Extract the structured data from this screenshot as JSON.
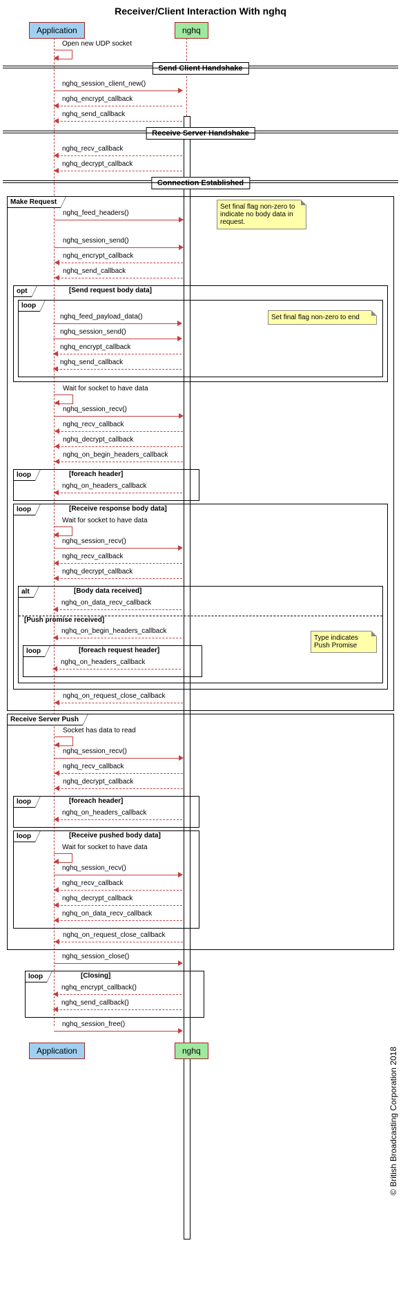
{
  "title": "Receiver/Client Interaction With nghq",
  "actors": {
    "app": "Application",
    "nghq": "nghq"
  },
  "dividers": {
    "send": "Send Client Handshake",
    "recv": "Receive Server Handshake",
    "est": "Connection Established"
  },
  "selfmsgs": {
    "openSocket": "Open new UDP socket",
    "waitData": "Wait for socket to have data",
    "socketData": "Socket has data to read"
  },
  "msgs": {
    "session_new": "nghq_session_client_new()",
    "encrypt_cb": "nghq_encrypt_callback",
    "send_cb": "nghq_send_callback",
    "recv_cb": "nghq_recv_callback",
    "decrypt_cb": "nghq_decrypt_callback",
    "feed_headers": "nghq_feed_headers()",
    "session_send": "nghq_session_send()",
    "feed_payload": "nghq_feed_payload_data()",
    "session_recv": "nghq_session_recv()",
    "begin_headers": "nghq_on_begin_headers_callback",
    "headers_cb": "nghq_on_headers_callback",
    "data_recv_cb": "nghq_on_data_recv_callback",
    "req_close_cb": "nghq_on_request_close_callback",
    "session_close": "nghq_session_close()",
    "encrypt_cb_call": "nghq_encrypt_callback()",
    "send_cb_call": "nghq_send_callback()",
    "session_free": "nghq_session_free()"
  },
  "groups": {
    "makeReq": "Make Request",
    "opt": "opt",
    "optTitle": "[Send request body data]",
    "loop": "loop",
    "foreachHeader": "[foreach header]",
    "recvBody": "[Receive response body data]",
    "alt": "alt",
    "altBody": "[Body data received]",
    "altPush": "[Push promise received]",
    "foreachReqHeader": "[foreach request header]",
    "recvPush": "Receive Server Push",
    "recvPushed": "[Receive pushed body data]",
    "closing": "[Closing]"
  },
  "notes": {
    "finalFlag": "Set final flag non-zero to indicate no body data in request.",
    "finalEnd": "Set final flag non-zero to end",
    "pushType": "Type indicates Push Promise"
  },
  "copyright": "© British Broadcasting Corporation 2018"
}
